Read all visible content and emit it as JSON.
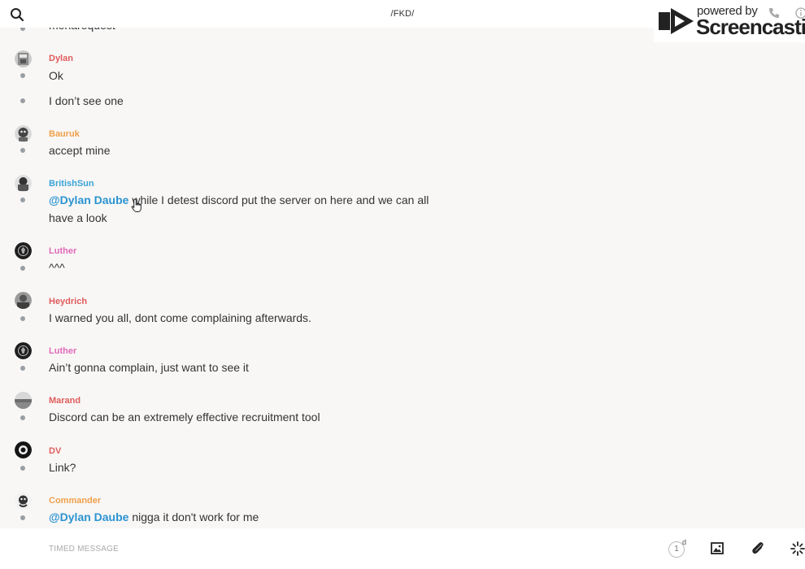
{
  "header": {
    "channel_title": "/FKD/"
  },
  "watermark": {
    "powered": "powered by",
    "brand": "Screencastify"
  },
  "messages": [
    {
      "author": "",
      "author_color": "#333333",
      "text_parts": [
        {
          "type": "text",
          "value": "menarequest"
        }
      ],
      "avatar": "none"
    },
    {
      "author": "Dylan",
      "author_color": "#e05c5c",
      "text_parts": [
        {
          "type": "text",
          "value": "Ok"
        }
      ],
      "avatar": "dylan-avatar"
    },
    {
      "author": "",
      "author_color": "#333333",
      "text_parts": [
        {
          "type": "text",
          "value": "I don’t see one"
        }
      ],
      "avatar": "none"
    },
    {
      "author": "Bauruk",
      "author_color": "#f0a04b",
      "text_parts": [
        {
          "type": "text",
          "value": "accept mine"
        }
      ],
      "avatar": "bauruk-avatar"
    },
    {
      "author": "BritishSun",
      "author_color": "#3aa3d8",
      "text_parts": [
        {
          "type": "mention",
          "value": "@Dylan Daube"
        },
        {
          "type": "text",
          "value": " while I detest discord put the server on here and we can all have a look"
        }
      ],
      "avatar": "britishsun-avatar"
    },
    {
      "author": "Luther",
      "author_color": "#e06ab8",
      "text_parts": [
        {
          "type": "text",
          "value": "^^^"
        }
      ],
      "avatar": "luther-avatar"
    },
    {
      "author": "Heydrich",
      "author_color": "#e05c5c",
      "text_parts": [
        {
          "type": "text",
          "value": "I warned you all, dont come complaining afterwards."
        }
      ],
      "avatar": "heydrich-avatar"
    },
    {
      "author": "Luther",
      "author_color": "#e06ab8",
      "text_parts": [
        {
          "type": "text",
          "value": "Ain’t gonna complain, just want to see it"
        }
      ],
      "avatar": "luther-avatar"
    },
    {
      "author": "Marand",
      "author_color": "#e05c5c",
      "text_parts": [
        {
          "type": "text",
          "value": "Discord can be an extremely effective recruitment tool"
        }
      ],
      "avatar": "marand-avatar"
    },
    {
      "author": "DV",
      "author_color": "#e05c5c",
      "text_parts": [
        {
          "type": "text",
          "value": "Link?"
        }
      ],
      "avatar": "dv-avatar"
    },
    {
      "author": "Commander",
      "author_color": "#f0a04b",
      "text_parts": [
        {
          "type": "mention",
          "value": "@Dylan Daube"
        },
        {
          "type": "text",
          "value": " nigga it don't work for me"
        }
      ],
      "avatar": "commander-avatar"
    }
  ],
  "composer": {
    "placeholder": "TIMED MESSAGE",
    "timer_value": "1",
    "timer_unit": "d"
  },
  "icons": {
    "search": "search-icon",
    "image": "image-icon",
    "attach": "paperclip-icon",
    "emoji": "sparkle-icon",
    "cursor": "hand-cursor-icon"
  },
  "colors": {
    "mention": "#2b93d1",
    "background": "#f8f7f6",
    "status_dot": "#9a9fa5"
  }
}
